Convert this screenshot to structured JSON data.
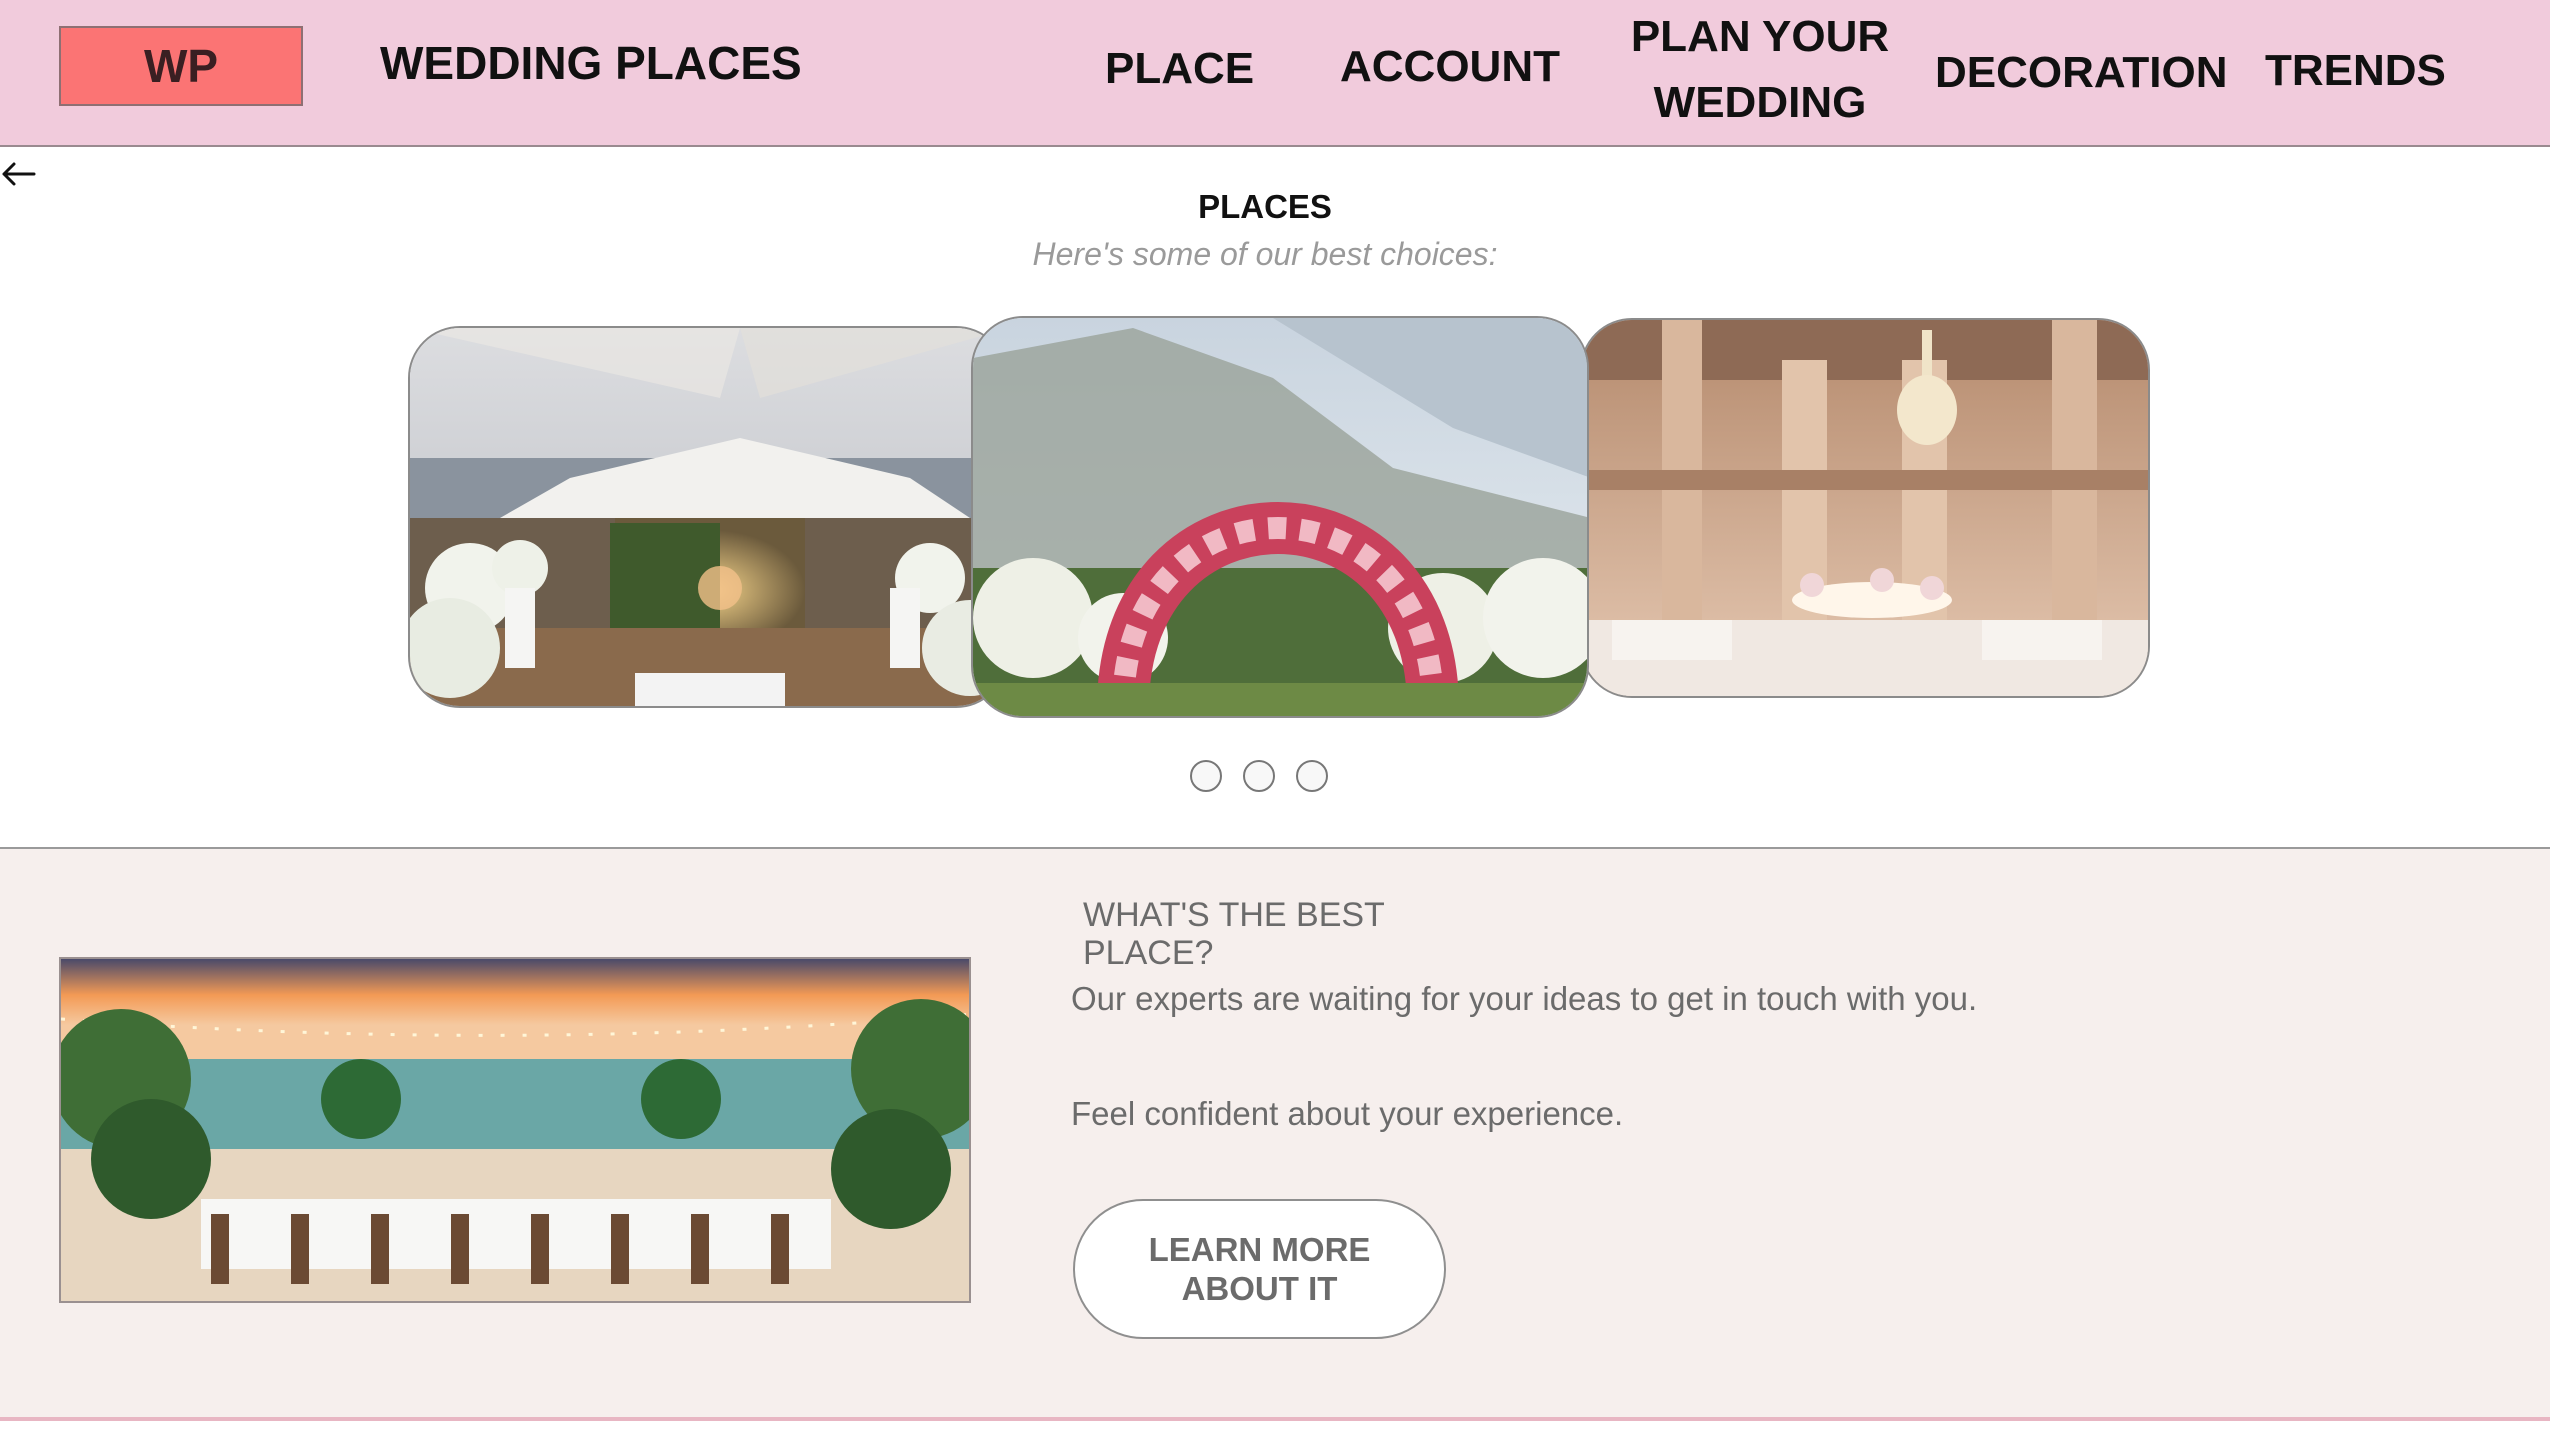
{
  "header": {
    "logo": "WP",
    "brand": "WEDDING PLACES",
    "nav": [
      {
        "label": "PLACE"
      },
      {
        "label": "ACCOUNT"
      },
      {
        "label": "PLAN YOUR WEDDING"
      },
      {
        "label": "DECORATION"
      },
      {
        "label": "TRENDS"
      }
    ]
  },
  "places": {
    "title": "PLACES",
    "subtitle": "Here's some of our best choices:",
    "slides": [
      "tent-venue",
      "floral-arch",
      "grand-ballroom"
    ],
    "dot_count": 3
  },
  "feature": {
    "question": "WHAT'S THE BEST PLACE?",
    "text1": "Our experts are waiting for your ideas to get in touch with you.",
    "text2": "Feel confident about your experience.",
    "button": "LEARN MORE ABOUT IT"
  },
  "icons": {
    "back": "arrow-left-icon"
  },
  "colors": {
    "header_bg": "#f1cbdc",
    "logo_bg": "#fb7474",
    "band_bg": "#f6efed"
  }
}
